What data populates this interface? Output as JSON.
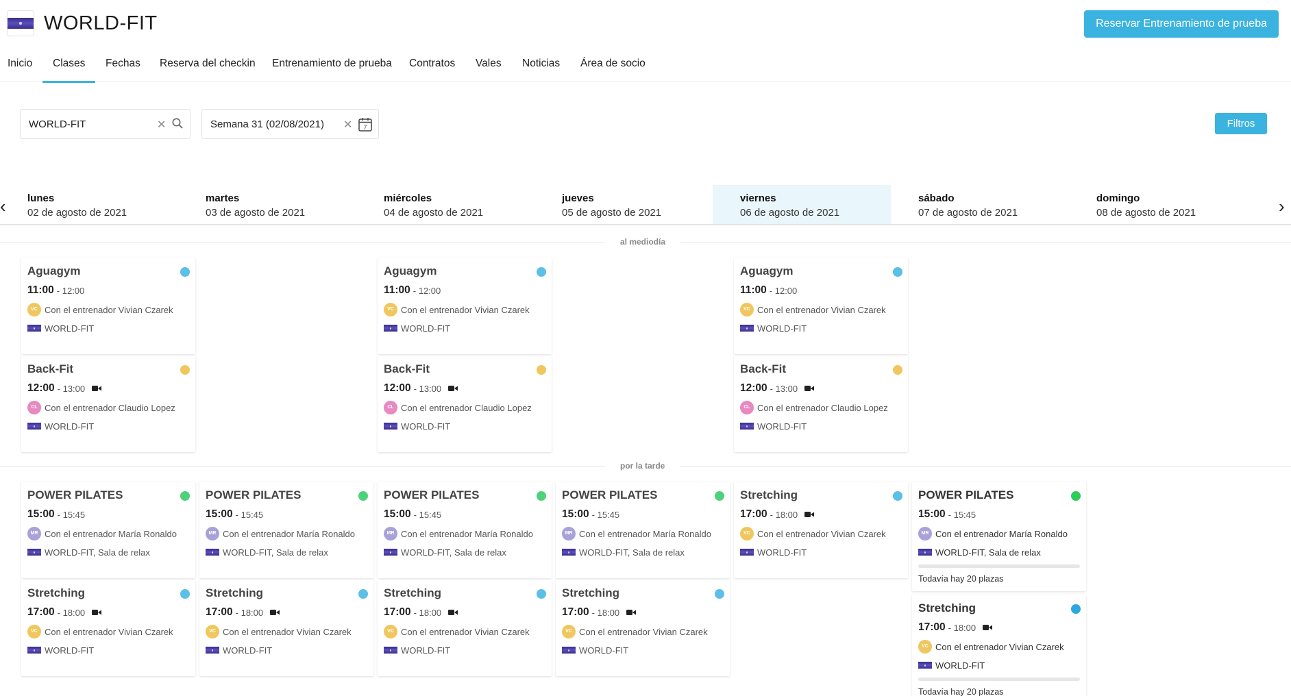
{
  "header": {
    "title": "WORLD-FIT",
    "trial_button": "Reservar Entrenamiento de prueba"
  },
  "nav": [
    {
      "label": "Inicio",
      "active": false
    },
    {
      "label": "Clases",
      "active": true
    },
    {
      "label": "Fechas",
      "active": false
    },
    {
      "label": "Reserva del checkin",
      "active": false
    },
    {
      "label": "Entrenamiento de prueba",
      "active": false
    },
    {
      "label": "Contratos",
      "active": false
    },
    {
      "label": "Vales",
      "active": false
    },
    {
      "label": "Noticias",
      "active": false
    },
    {
      "label": "Área de socio",
      "active": false
    }
  ],
  "filters": {
    "studio_value": "WORLD-FIT",
    "week_value": "Semana 31 (02/08/2021)",
    "calendar_day": "7",
    "filters_button": "Filtros"
  },
  "days": [
    {
      "name": "lunes",
      "date": "02 de agosto de 2021"
    },
    {
      "name": "martes",
      "date": "03 de agosto de 2021"
    },
    {
      "name": "miércoles",
      "date": "04 de agosto de 2021"
    },
    {
      "name": "jueves",
      "date": "05 de agosto de 2021"
    },
    {
      "name": "viernes",
      "date": "06 de agosto de 2021",
      "today": true
    },
    {
      "name": "sábado",
      "date": "07 de agosto de 2021"
    },
    {
      "name": "domingo",
      "date": "08 de agosto de 2021"
    }
  ],
  "colors": {
    "accent": "#3bb3e0",
    "aguagym": "#5bbfe8",
    "backfit": "#f0c75e",
    "pilates": "#4fd17a",
    "pilates_strong": "#2ecc5a",
    "stretching": "#5bbfe8",
    "stretching_strong": "#2aa8e0",
    "avatar_vc": "#f0c75e",
    "avatar_cl": "#e889c2",
    "avatar_mr": "#a9a1d9"
  },
  "sections": {
    "midday": "al mediodía",
    "afternoon": "por la tarde"
  },
  "classes": {
    "aguagym": {
      "name": "Aguagym",
      "start": "11:00",
      "end": "- 12:00",
      "trainer": "Con el entrenador Vivian Czarek",
      "initials": "VC",
      "location": "WORLD-FIT"
    },
    "backfit": {
      "name": "Back-Fit",
      "start": "12:00",
      "end": "- 13:00",
      "trainer": "Con el entrenador Claudio Lopez",
      "initials": "CL",
      "location": "WORLD-FIT"
    },
    "pilates": {
      "name": "POWER PILATES",
      "start": "15:00",
      "end": "- 15:45",
      "trainer": "Con el entrenador María Ronaldo",
      "initials": "MR",
      "location": "WORLD-FIT, Sala de relax"
    },
    "stretching_pm": {
      "name": "Stretching",
      "start": "17:00",
      "end": "- 18:00",
      "trainer": "Con el entrenador Vivian Czarek",
      "initials": "VC",
      "location": "WORLD-FIT"
    }
  },
  "saturday": {
    "availability": "Todavía hay 20 plazas",
    "availability_fraction": 0.0
  }
}
